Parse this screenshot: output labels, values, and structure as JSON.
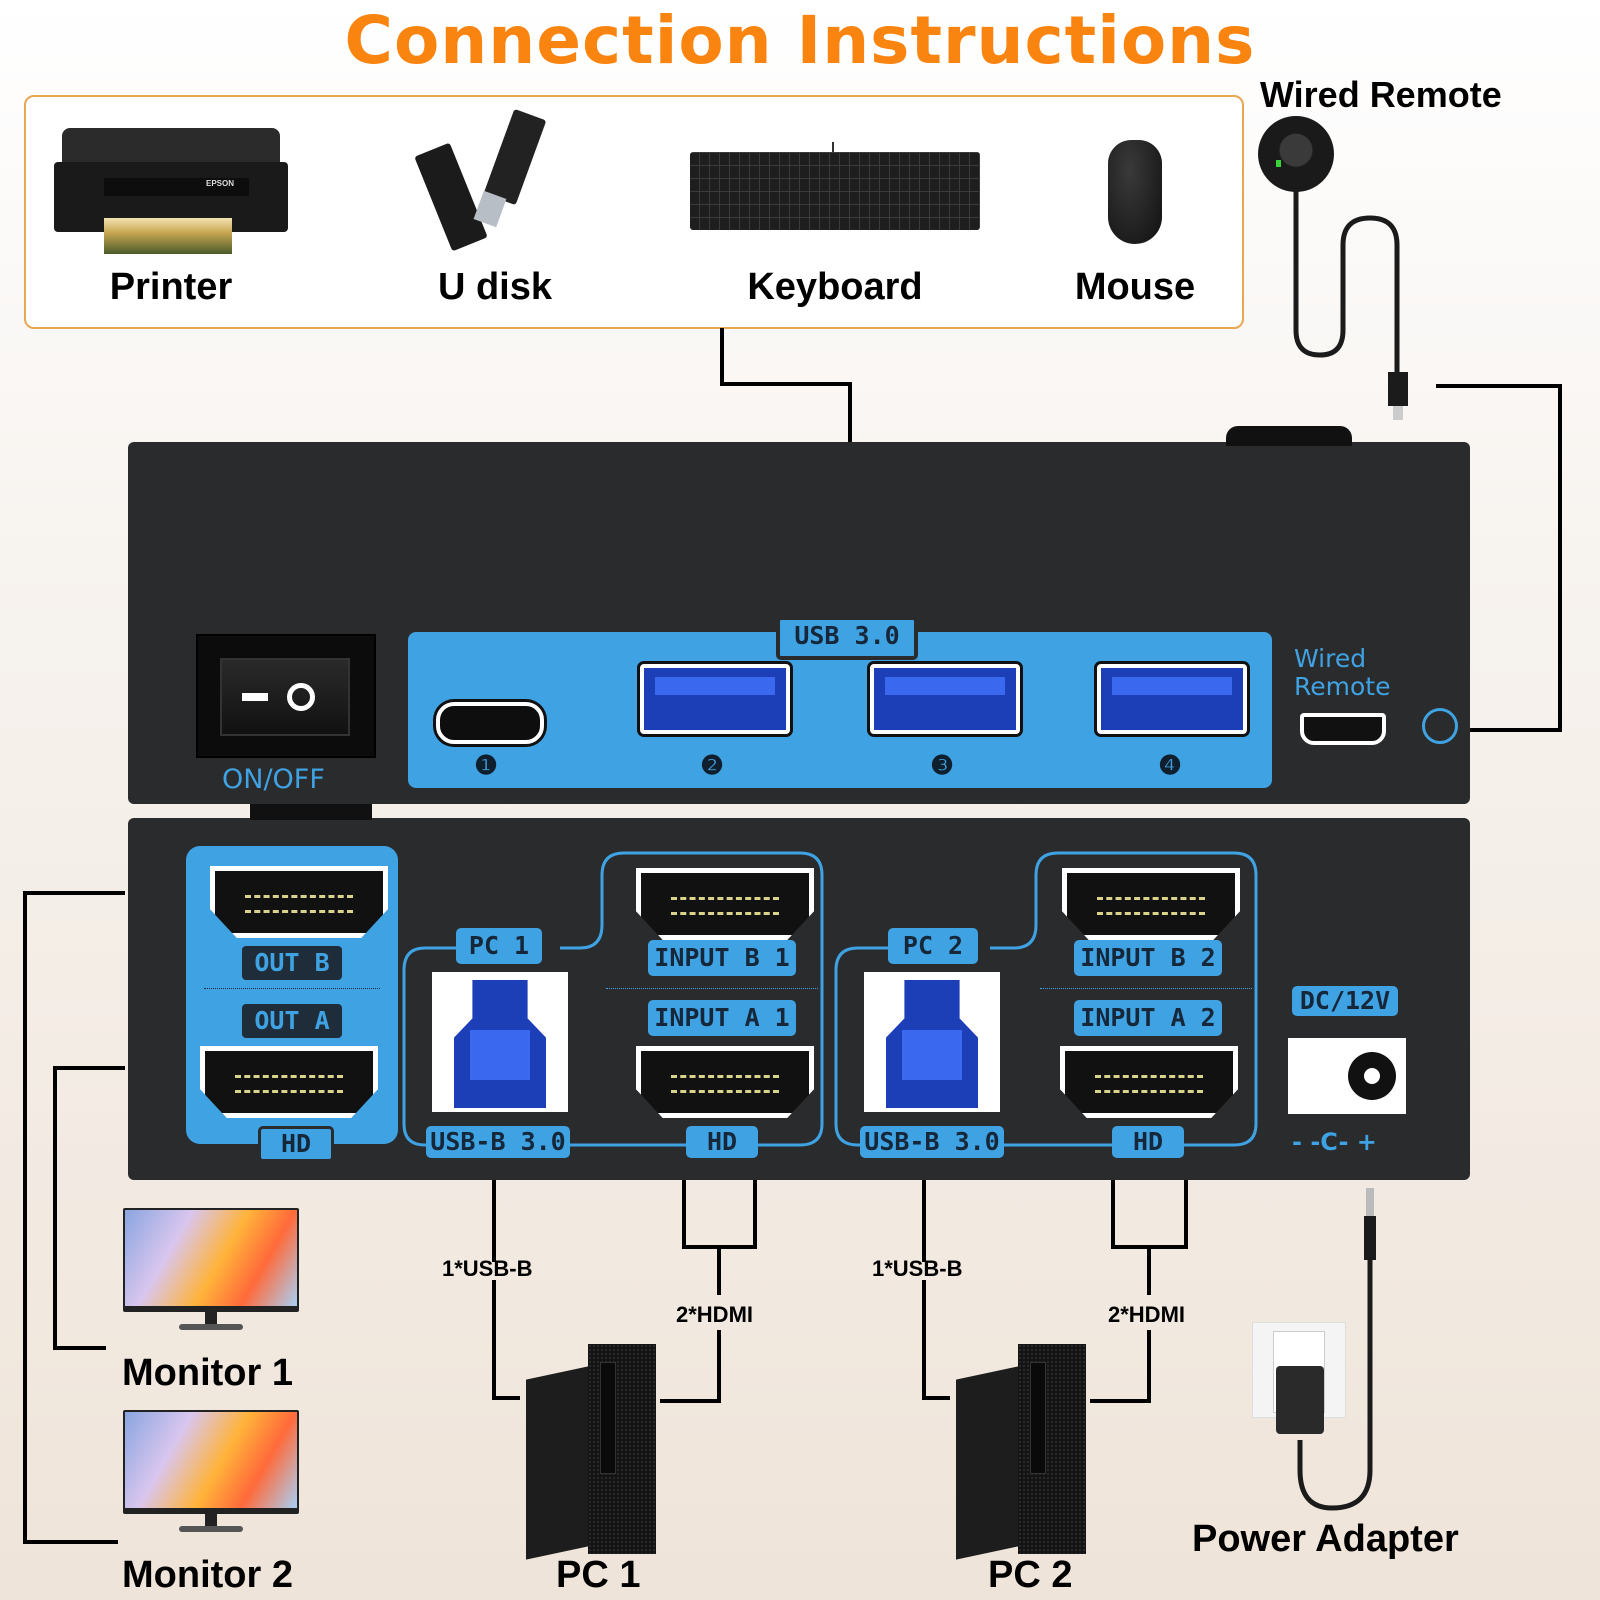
{
  "title": "Connection Instructions",
  "peripherals": [
    {
      "label": "Printer",
      "icon": "printer-icon"
    },
    {
      "label": "U disk",
      "icon": "usb-drive-icon"
    },
    {
      "label": "Keyboard",
      "icon": "keyboard-icon"
    },
    {
      "label": "Mouse",
      "icon": "mouse-icon"
    }
  ],
  "printer_brand": "EPSON",
  "wired_remote": {
    "label": "Wired Remote"
  },
  "front_panel": {
    "power_switch_label": "ON/OFF",
    "usb_group_label": "USB 3.0",
    "usb_ports": [
      {
        "number": "❶",
        "type": "USB-C"
      },
      {
        "number": "❷",
        "type": "USB-A"
      },
      {
        "number": "❸",
        "type": "USB-A"
      },
      {
        "number": "❹",
        "type": "USB-A"
      }
    ],
    "remote_port_label_line1": "Wired",
    "remote_port_label_line2": "Remote"
  },
  "rear_panel": {
    "outputs": {
      "out_b": "OUT B",
      "out_a": "OUT A",
      "hd": "HD"
    },
    "pc1": {
      "label": "PC 1",
      "input_b": "INPUT B 1",
      "input_a": "INPUT A 1",
      "usb_label": "USB-B 3.0",
      "hd": "HD"
    },
    "pc2": {
      "label": "PC 2",
      "input_b": "INPUT B 2",
      "input_a": "INPUT A 2",
      "usb_label": "USB-B 3.0",
      "hd": "HD"
    },
    "dc_label": "DC/12V",
    "polarity": "- -C- +"
  },
  "cables": {
    "pc1_usb": "1*USB-B",
    "pc1_hdmi": "2*HDMI",
    "pc2_usb": "1*USB-B",
    "pc2_hdmi": "2*HDMI"
  },
  "devices": {
    "monitor1": "Monitor 1",
    "monitor2": "Monitor 2",
    "pc1": "PC 1",
    "pc2": "PC 2",
    "power_adapter": "Power Adapter"
  },
  "colors": {
    "title_orange": "#fa8410",
    "accent_blue": "#3fa2e2",
    "device_body": "#2a2b2d",
    "box_border": "#e8a752"
  }
}
